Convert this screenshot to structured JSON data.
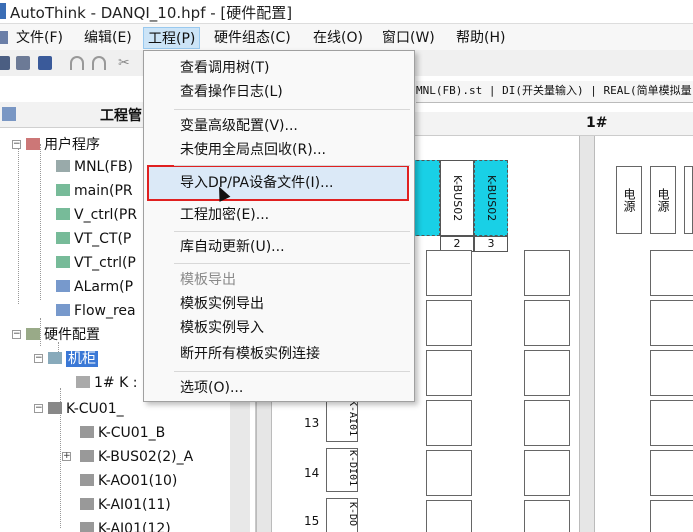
{
  "window": {
    "title": "AutoThink - DANQI_10.hpf - [硬件配置]"
  },
  "menubar": {
    "items": [
      {
        "label": "文件(F)"
      },
      {
        "label": "编辑(E)"
      },
      {
        "label": "工程(P)"
      },
      {
        "label": "硬件组态(C)"
      },
      {
        "label": "在线(O)"
      },
      {
        "label": "窗口(W)"
      },
      {
        "label": "帮助(H)"
      }
    ]
  },
  "project_menu": {
    "items": [
      {
        "label": "查看调用树(T)"
      },
      {
        "label": "查看操作日志(L)"
      },
      {
        "label": "变量高级配置(V)..."
      },
      {
        "label": "未使用全局点回收(R)..."
      },
      {
        "label": "导入DP/PA设备文件(I)..."
      },
      {
        "label": "工程加密(E)..."
      },
      {
        "label": "库自动更新(U)..."
      },
      {
        "label": "模板导出"
      },
      {
        "label": "模板实例导出"
      },
      {
        "label": "模板实例导入"
      },
      {
        "label": "断开所有模板实例连接"
      },
      {
        "label": "选项(O)..."
      }
    ]
  },
  "left_panel": {
    "title": "工程管",
    "tree": {
      "user_program": "用户程序",
      "programs": [
        "MNL(FB)",
        "main(PR",
        "V_ctrl(PR",
        "VT_CT(P",
        "VT_ctrl(P",
        "ALarm(P",
        "Flow_rea"
      ],
      "hardware": "硬件配置",
      "cabinet": "机柜",
      "rack": "1# K :",
      "controller": "K-CU01_",
      "modules": [
        "K-CU01_B",
        "K-BUS02(2)_A",
        "K-AO01(10)",
        "K-AI01(11)",
        "K-AI01(12)"
      ]
    }
  },
  "editor": {
    "tabs_text": "MNL(FB).st | DI(开关量输入) | REAL(简单模拟量",
    "rack_label": "1#",
    "modules": [
      {
        "name": "K-BUS02",
        "slot": "2"
      },
      {
        "name": "K-BUS02",
        "slot": "3"
      }
    ],
    "power_label": "电源",
    "row_numbers": [
      "13",
      "14",
      "15"
    ],
    "row_modules": [
      "K-AI01",
      "K-DI01",
      "K-DO"
    ]
  },
  "colors": {
    "highlight_border": "#e02020",
    "module_cyan": "#19d0e6",
    "selection": "#3a78d6"
  }
}
